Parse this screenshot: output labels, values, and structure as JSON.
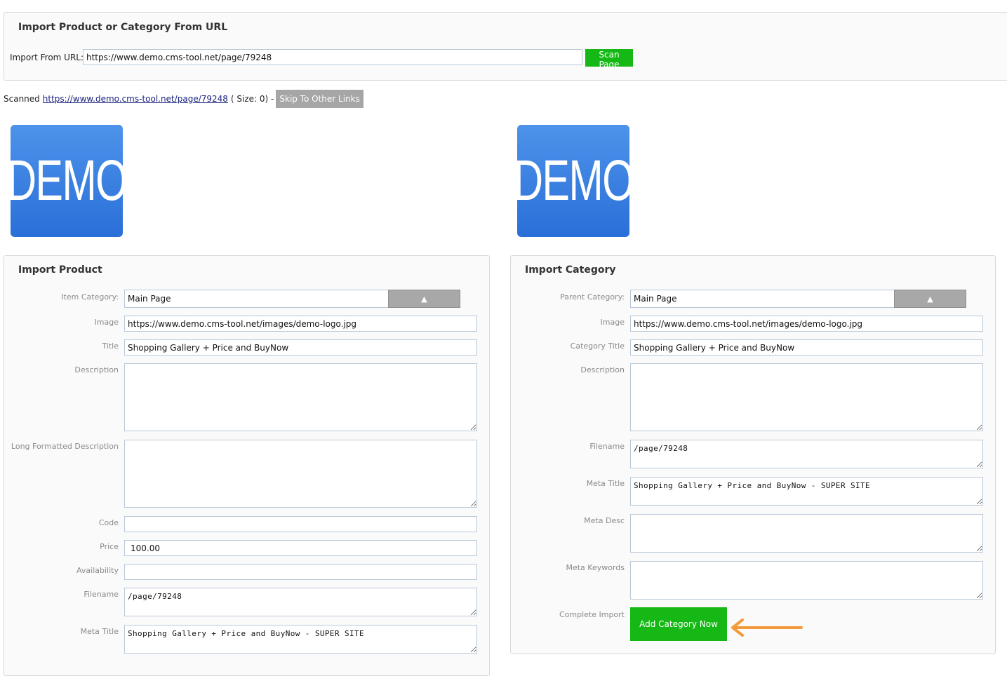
{
  "url_panel": {
    "title": "Import Product or Category From URL",
    "url_label": "Import From URL:",
    "url_value": "https://www.demo.cms-tool.net/page/79248",
    "scan_button": "Scan Page"
  },
  "scanned": {
    "prefix": "Scanned",
    "link": "https://www.demo.cms-tool.net/page/79248",
    "size_text": "( Size: 0) -",
    "skip_button": "Skip To Other Links"
  },
  "logo_text": "DEMO",
  "colors": {
    "accent_green": "#16b816",
    "logo_blue": "#2a6fd8",
    "arrow_orange": "#f39a3a"
  },
  "product": {
    "title": "Import Product",
    "item_category_label": "Item Category:",
    "item_category_value": "Main Page",
    "image_label": "Image",
    "image_value": "https://www.demo.cms-tool.net/images/demo-logo.jpg",
    "title_label": "Title",
    "title_value": "Shopping Gallery + Price and BuyNow",
    "description_label": "Description",
    "description_value": "",
    "long_desc_label": "Long Formatted Description",
    "long_desc_value": "",
    "code_label": "Code",
    "code_value": "",
    "price_label": "Price",
    "price_value": "100.00",
    "availability_label": "Availability",
    "availability_value": "",
    "filename_label": "Filename",
    "filename_value": "/page/79248",
    "meta_title_label": "Meta Title",
    "meta_title_value": "Shopping Gallery + Price and BuyNow - SUPER SITE"
  },
  "category": {
    "title": "Import Category",
    "parent_category_label": "Parent Category:",
    "parent_category_value": "Main Page",
    "image_label": "Image",
    "image_value": "https://www.demo.cms-tool.net/images/demo-logo.jpg",
    "category_title_label": "Category Title",
    "category_title_value": "Shopping Gallery + Price and BuyNow",
    "description_label": "Description",
    "description_value": "",
    "filename_label": "Filename",
    "filename_value": "/page/79248",
    "meta_title_label": "Meta Title",
    "meta_title_value": "Shopping Gallery + Price and BuyNow - SUPER SITE",
    "meta_desc_label": "Meta Desc",
    "meta_desc_value": "",
    "meta_keywords_label": "Meta Keywords",
    "meta_keywords_value": "",
    "complete_label": "Complete Import",
    "add_button": "Add Category Now"
  }
}
